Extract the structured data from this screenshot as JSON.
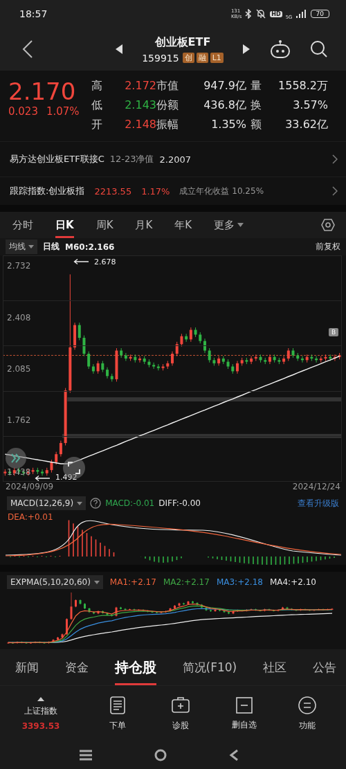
{
  "status_bar": {
    "time": "18:57",
    "net_speed": "131",
    "net_unit": "KB/s",
    "hd": "HD",
    "network": "5G",
    "battery": "70"
  },
  "header": {
    "title": "创业板ETF",
    "code": "159915",
    "badges": [
      "创",
      "融",
      "L1"
    ]
  },
  "quote": {
    "price": "2.170",
    "change": "0.023",
    "change_pct": "1.07%",
    "rows": [
      {
        "cells": [
          {
            "label": "高",
            "value": "2.172",
            "color": "#f0463c"
          },
          {
            "label": "市值",
            "value": "947.9亿",
            "color": "#e6e6e6"
          },
          {
            "label": "量",
            "value": "1558.2万",
            "color": "#e6e6e6"
          }
        ]
      },
      {
        "cells": [
          {
            "label": "低",
            "value": "2.143",
            "color": "#2fb344"
          },
          {
            "label": "份额",
            "value": "436.8亿",
            "color": "#e6e6e6"
          },
          {
            "label": "换",
            "value": "3.57%",
            "color": "#e6e6e6"
          }
        ]
      },
      {
        "cells": [
          {
            "label": "开",
            "value": "2.148",
            "color": "#f0463c"
          },
          {
            "label": "振幅",
            "value": "1.35%",
            "color": "#e6e6e6"
          },
          {
            "label": "额",
            "value": "33.62亿",
            "color": "#e6e6e6"
          }
        ]
      }
    ]
  },
  "fund_row": {
    "name": "易方达创业板ETF联接C",
    "date_label": "12-23净值",
    "nav": "2.2007"
  },
  "index_row": {
    "label": "跟踪指数:创业板指",
    "value": "2213.55",
    "change_pct": "1.17%",
    "annual": "成立年化收益 10.25%"
  },
  "period_tabs": [
    {
      "label": "分时",
      "selected": false,
      "has_menu": false
    },
    {
      "label": "日K",
      "selected": true,
      "has_menu": false
    },
    {
      "label": "周K",
      "selected": false,
      "has_menu": false
    },
    {
      "label": "月K",
      "selected": false,
      "has_menu": false
    },
    {
      "label": "年K",
      "selected": false,
      "has_menu": false
    },
    {
      "label": "更多",
      "selected": false,
      "has_menu": true
    }
  ],
  "chart": {
    "ma_selector": "均线",
    "line_type": "日线",
    "adjust": "前复权",
    "chart_data": {
      "type": "candlestick",
      "ylim": [
        1.377,
        2.797
      ],
      "yticks": [
        2.732,
        2.408,
        2.085,
        1.762,
        1.438
      ],
      "ref_lines": [
        {
          "axis": "y",
          "value": 2.17
        }
      ],
      "bands": [
        {
          "axis": "y",
          "from": 1.881,
          "to": 1.907
        },
        {
          "axis": "y",
          "from": 1.651,
          "to": 1.677
        }
      ],
      "ohlc": [
        [
          1.43,
          1.455,
          1.415,
          1.44
        ],
        [
          1.44,
          1.455,
          1.415,
          1.43
        ],
        [
          1.43,
          1.465,
          1.415,
          1.45
        ],
        [
          1.45,
          1.465,
          1.425,
          1.44
        ],
        [
          1.44,
          1.455,
          1.415,
          1.43
        ],
        [
          1.43,
          1.455,
          1.415,
          1.44
        ],
        [
          1.44,
          1.465,
          1.425,
          1.45
        ],
        [
          1.45,
          1.465,
          1.425,
          1.44
        ],
        [
          1.44,
          1.455,
          1.415,
          1.43
        ],
        [
          1.43,
          1.465,
          1.415,
          1.45
        ],
        [
          1.45,
          1.515,
          1.435,
          1.5
        ],
        [
          1.5,
          1.565,
          1.485,
          1.55
        ],
        [
          1.55,
          1.635,
          1.535,
          1.62
        ],
        [
          1.62,
          1.965,
          1.605,
          1.95
        ],
        [
          1.95,
          2.678,
          1.935,
          2.22
        ],
        [
          2.22,
          2.375,
          2.205,
          2.36
        ],
        [
          2.36,
          2.375,
          2.265,
          2.28
        ],
        [
          2.28,
          2.295,
          2.165,
          2.18
        ],
        [
          2.18,
          2.195,
          2.085,
          2.1
        ],
        [
          2.1,
          2.115,
          2.055,
          2.07
        ],
        [
          2.07,
          2.135,
          2.055,
          2.12
        ],
        [
          2.12,
          2.135,
          2.065,
          2.08
        ],
        [
          2.08,
          2.095,
          2.025,
          2.04
        ],
        [
          2.04,
          2.055,
          2.005,
          2.02
        ],
        [
          2.02,
          2.215,
          2.005,
          2.2
        ],
        [
          2.2,
          2.215,
          2.155,
          2.17
        ],
        [
          2.17,
          2.185,
          2.135,
          2.15
        ],
        [
          2.15,
          2.175,
          2.135,
          2.16
        ],
        [
          2.16,
          2.175,
          2.125,
          2.14
        ],
        [
          2.14,
          2.165,
          2.125,
          2.15
        ],
        [
          2.15,
          2.165,
          2.115,
          2.13
        ],
        [
          2.13,
          2.145,
          2.095,
          2.11
        ],
        [
          2.11,
          2.125,
          2.085,
          2.1
        ],
        [
          2.1,
          2.115,
          2.075,
          2.09
        ],
        [
          2.09,
          2.115,
          2.075,
          2.1
        ],
        [
          2.1,
          2.135,
          2.085,
          2.12
        ],
        [
          2.12,
          2.195,
          2.105,
          2.18
        ],
        [
          2.18,
          2.255,
          2.165,
          2.24
        ],
        [
          2.24,
          2.305,
          2.225,
          2.29
        ],
        [
          2.29,
          2.305,
          2.255,
          2.27
        ],
        [
          2.27,
          2.345,
          2.255,
          2.33
        ],
        [
          2.33,
          2.345,
          2.285,
          2.3
        ],
        [
          2.3,
          2.315,
          2.245,
          2.26
        ],
        [
          2.26,
          2.275,
          2.185,
          2.2
        ],
        [
          2.2,
          2.215,
          2.125,
          2.14
        ],
        [
          2.14,
          2.155,
          2.105,
          2.12
        ],
        [
          2.12,
          2.165,
          2.105,
          2.15
        ],
        [
          2.15,
          2.165,
          2.115,
          2.13
        ],
        [
          2.13,
          2.145,
          2.085,
          2.1
        ],
        [
          2.1,
          2.115,
          2.055,
          2.07
        ],
        [
          2.07,
          2.135,
          2.055,
          2.12
        ],
        [
          2.12,
          2.155,
          2.105,
          2.14
        ],
        [
          2.14,
          2.155,
          2.115,
          2.13
        ],
        [
          2.13,
          2.165,
          2.115,
          2.15
        ],
        [
          2.15,
          2.175,
          2.135,
          2.16
        ],
        [
          2.16,
          2.175,
          2.125,
          2.14
        ],
        [
          2.14,
          2.155,
          2.115,
          2.13
        ],
        [
          2.13,
          2.175,
          2.115,
          2.16
        ],
        [
          2.16,
          2.175,
          2.125,
          2.14
        ],
        [
          2.14,
          2.155,
          2.115,
          2.13
        ],
        [
          2.13,
          2.165,
          2.115,
          2.15
        ],
        [
          2.15,
          2.215,
          2.135,
          2.2
        ],
        [
          2.2,
          2.215,
          2.155,
          2.17
        ],
        [
          2.17,
          2.185,
          2.135,
          2.15
        ],
        [
          2.15,
          2.165,
          2.125,
          2.14
        ],
        [
          2.14,
          2.175,
          2.125,
          2.16
        ],
        [
          2.16,
          2.175,
          2.135,
          2.15
        ],
        [
          2.15,
          2.165,
          2.125,
          2.14
        ],
        [
          2.14,
          2.165,
          2.125,
          2.15
        ],
        [
          2.15,
          2.175,
          2.135,
          2.16
        ],
        [
          2.16,
          2.175,
          2.135,
          2.15
        ],
        [
          2.15,
          2.175,
          2.135,
          2.16
        ],
        [
          2.16,
          2.185,
          2.145,
          2.17
        ]
      ],
      "series": [
        {
          "name": "M60:2.166",
          "type": "line",
          "color": "#f2f2f2",
          "values": [
            1.55,
            1.545,
            1.54,
            1.535,
            1.53,
            1.525,
            1.52,
            1.515,
            1.51,
            1.505,
            1.5,
            1.495,
            1.49,
            1.49,
            1.49,
            1.502,
            1.513,
            1.525,
            1.537,
            1.548,
            1.56,
            1.571,
            1.583,
            1.595,
            1.606,
            1.618,
            1.63,
            1.641,
            1.653,
            1.665,
            1.676,
            1.688,
            1.699,
            1.711,
            1.723,
            1.734,
            1.746,
            1.758,
            1.769,
            1.781,
            1.792,
            1.804,
            1.816,
            1.827,
            1.839,
            1.851,
            1.862,
            1.874,
            1.886,
            1.897,
            1.909,
            1.92,
            1.932,
            1.944,
            1.955,
            1.967,
            1.979,
            1.99,
            2.002,
            2.013,
            2.025,
            2.037,
            2.048,
            2.06,
            2.072,
            2.083,
            2.095,
            2.106,
            2.118,
            2.13,
            2.141,
            2.153,
            2.165
          ]
        }
      ]
    },
    "high_mark": "2.678",
    "low_mark": "1.492",
    "marker": "B",
    "start_date": "2024/09/09",
    "end_date": "2024/12/24"
  },
  "macd": {
    "selector": "MACD(12,26,9)",
    "values": [
      {
        "text": "MACD:-0.01",
        "color": "#2fa84f"
      },
      {
        "text": "DIFF:-0.00",
        "color": "#e6e6e6"
      }
    ],
    "upgrade": "查看升级版",
    "dea": "DEA:+0.01"
  },
  "expma": {
    "selector": "EXPMA(5,10,20,60)",
    "values": [
      {
        "text": "MA1:+2.17",
        "color": "#f0643c"
      },
      {
        "text": "MA2:+2.17",
        "color": "#3fa845"
      },
      {
        "text": "MA3:+2.18",
        "color": "#3a8fe0"
      },
      {
        "text": "MA4:+2.10",
        "color": "#e6e6e6"
      }
    ]
  },
  "bottom_tabs": [
    {
      "label": "新闻",
      "selected": false
    },
    {
      "label": "资金",
      "selected": false
    },
    {
      "label": "持仓股",
      "selected": true
    },
    {
      "label": "简况(F10)",
      "selected": false
    },
    {
      "label": "社区",
      "selected": false
    },
    {
      "label": "公告",
      "selected": false
    }
  ],
  "toolbar": {
    "index_label": "上证指数",
    "index_value": "3393.53",
    "actions": [
      {
        "label": "下单",
        "kind": "order"
      },
      {
        "label": "诊股",
        "kind": "diagnose"
      },
      {
        "label": "删自选",
        "kind": "remove"
      },
      {
        "label": "功能",
        "kind": "menu"
      }
    ]
  }
}
